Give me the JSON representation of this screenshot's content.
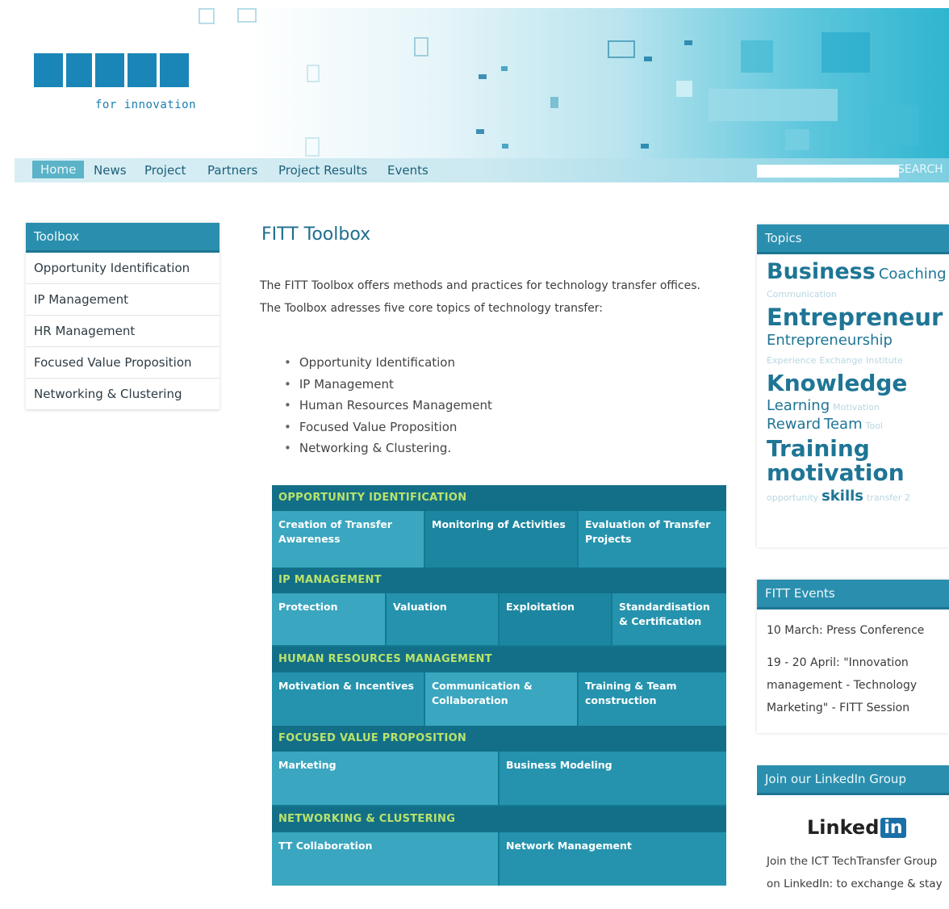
{
  "header": {
    "logo_subtitle": "for innovation",
    "nav": [
      "Home",
      "News",
      "Project",
      "Partners",
      "Project Results",
      "Events"
    ],
    "search_label": "SEARCH",
    "search_value": ""
  },
  "left": {
    "title": "Toolbox",
    "items": [
      "Opportunity Identification",
      "IP Management",
      "HR Management",
      "Focused Value Proposition",
      "Networking & Clustering"
    ]
  },
  "main": {
    "title": "FITT Toolbox",
    "intro": "The FITT Toolbox offers methods and practices for technology transfer offices. The Toolbox adresses five core topics of technology transfer:",
    "topics": [
      "Opportunity Identification",
      "IP Management",
      "Human Resources Management",
      "Focused Value Proposition",
      "Networking & Clustering."
    ],
    "matrix": [
      {
        "heading": "OPPORTUNITY IDENTIFICATION",
        "cells": [
          "Creation of Transfer Awareness",
          "Monitoring of Activities",
          "Evaluation of Transfer Projects"
        ]
      },
      {
        "heading": "IP MANAGEMENT",
        "cells": [
          "Protection",
          "Valuation",
          "Exploitation",
          "Standardisation & Certification"
        ]
      },
      {
        "heading": "HUMAN RESOURCES MANAGEMENT",
        "cells": [
          "Motivation & Incentives",
          "Communication & Collaboration",
          "Training & Team construction"
        ]
      },
      {
        "heading": "FOCUSED VALUE PROPOSITION",
        "cells": [
          "Marketing",
          "Business Modeling"
        ]
      },
      {
        "heading": "NETWORKING & CLUSTERING",
        "cells": [
          "TT Collaboration",
          "Network Management"
        ]
      }
    ]
  },
  "topics": {
    "title": "Topics",
    "tags": [
      "Business",
      "Coaching",
      "Communication",
      "Entrepreneur",
      "Entrepreneurship",
      "Experience",
      "Exchange",
      "Institute",
      "Knowledge",
      "Learning",
      "Motivation",
      "Reward",
      "Team",
      "Tool",
      "Training",
      "motivation",
      "opportunity",
      "skills",
      "transfer 2"
    ]
  },
  "events": {
    "title": "FITT Events",
    "items": [
      "10 March: Press Conference",
      "19 - 20 April: \"Innovation",
      "management - Technology",
      "Marketing\" - FITT Session"
    ]
  },
  "linkedin": {
    "title": "Join our LinkedIn Group",
    "logo_text": "Linked",
    "logo_in": "in",
    "text_line1": "Join the ICT TechTransfer Group",
    "text_line2": "on LinkedIn: to exchange & stay"
  }
}
